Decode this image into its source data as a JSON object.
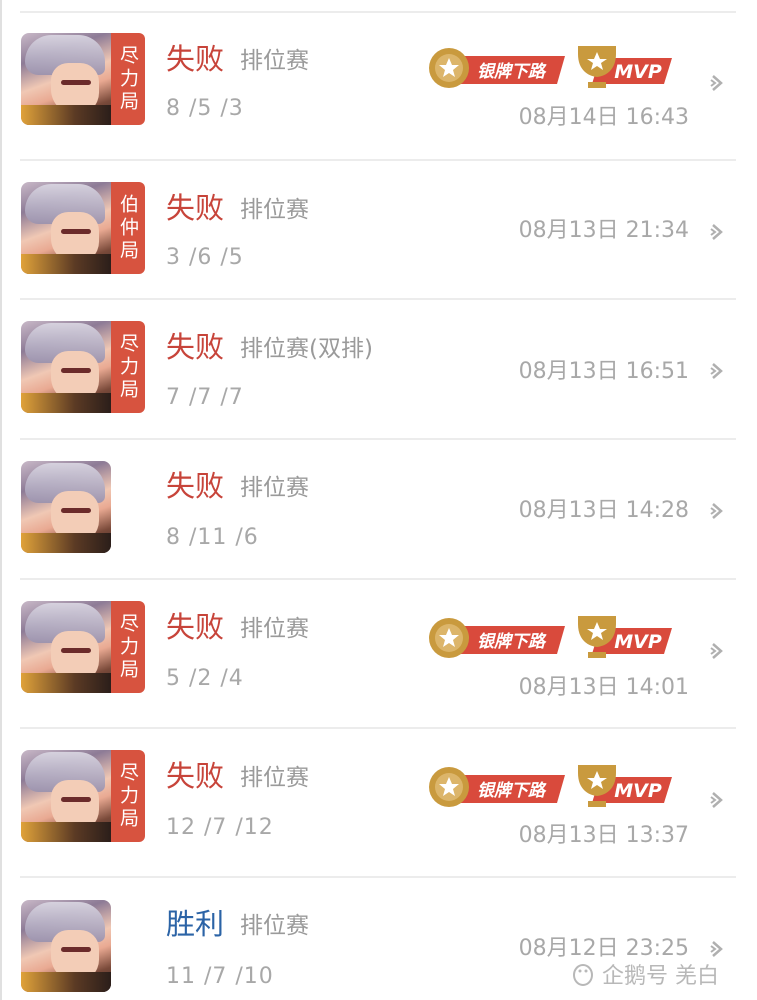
{
  "matches": [
    {
      "result": "失败",
      "result_type": "loss",
      "mode": "排位赛",
      "kda": "8 /5 /3",
      "time": "08月14日 16:43",
      "badge": "尽力局",
      "silver_tag": "银牌下路",
      "mvp_tag": "MVP"
    },
    {
      "result": "失败",
      "result_type": "loss",
      "mode": "排位赛",
      "kda": "3 /6 /5",
      "time": "08月13日 21:34",
      "badge": "伯仲局",
      "silver_tag": "",
      "mvp_tag": ""
    },
    {
      "result": "失败",
      "result_type": "loss",
      "mode": "排位赛(双排)",
      "kda": "7 /7 /7",
      "time": "08月13日 16:51",
      "badge": "尽力局",
      "silver_tag": "",
      "mvp_tag": ""
    },
    {
      "result": "失败",
      "result_type": "loss",
      "mode": "排位赛",
      "kda": "8 /11 /6",
      "time": "08月13日 14:28",
      "badge": "",
      "silver_tag": "",
      "mvp_tag": ""
    },
    {
      "result": "失败",
      "result_type": "loss",
      "mode": "排位赛",
      "kda": "5 /2 /4",
      "time": "08月13日 14:01",
      "badge": "尽力局",
      "silver_tag": "银牌下路",
      "mvp_tag": "MVP"
    },
    {
      "result": "失败",
      "result_type": "loss",
      "mode": "排位赛",
      "kda": "12 /7 /12",
      "time": "08月13日 13:37",
      "badge": "尽力局",
      "silver_tag": "银牌下路",
      "mvp_tag": "MVP"
    },
    {
      "result": "胜利",
      "result_type": "win",
      "mode": "排位赛",
      "kda": "11 /7 /10",
      "time": "08月12日 23:25",
      "badge": "",
      "silver_tag": "",
      "mvp_tag": ""
    }
  ],
  "watermark": {
    "text": "企鹅号 羌白"
  },
  "colors": {
    "loss": "#c7443a",
    "win": "#2b63a6",
    "badge": "#d7533f",
    "ribbon": "#d94a3c",
    "medal": "#c99a3e"
  }
}
